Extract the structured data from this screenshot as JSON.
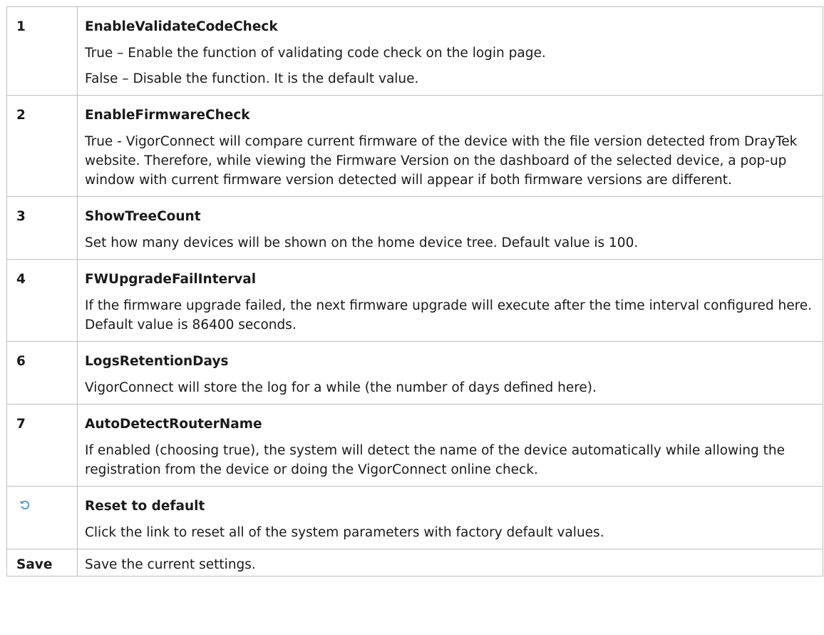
{
  "rows": [
    {
      "key": "1",
      "name": "EnableValidateCodeCheck",
      "lines": [
        "True – Enable the function of validating code check on the login page.",
        "False – Disable the function. It is the default value."
      ]
    },
    {
      "key": "2",
      "name": "EnableFirmwareCheck",
      "lines": [
        "True - VigorConnect will compare current firmware of the device with the file version detected from DrayTek website. Therefore, while viewing the Firmware Version on the dashboard of the selected device, a pop-up window with current firmware version detected will appear if both firmware versions are different."
      ]
    },
    {
      "key": "3",
      "name": "ShowTreeCount",
      "lines": [
        "Set how many devices will be shown on the home device tree. Default value is 100."
      ]
    },
    {
      "key": "4",
      "name": "FWUpgradeFailInterval",
      "lines": [
        "If the firmware upgrade failed, the next firmware upgrade will execute after the time interval configured here. Default value is 86400 seconds."
      ]
    },
    {
      "key": "6",
      "name": "LogsRetentionDays",
      "lines": [
        "VigorConnect will store the log for a while (the number of days defined here)."
      ]
    },
    {
      "key": "7",
      "name": "AutoDetectRouterName",
      "lines": [
        "If enabled (choosing true), the system will detect the name of the device automatically while allowing the registration from the device or doing the VigorConnect online check."
      ]
    },
    {
      "key": "",
      "icon": "reset-icon",
      "name": "Reset to default",
      "lines": [
        "Click the link to reset all of the system parameters with factory default values."
      ]
    },
    {
      "key": "Save",
      "name": "",
      "lines": [
        "Save the current settings."
      ]
    }
  ],
  "colors": {
    "border": "#bfbfbf",
    "icon": "#4a90c8"
  }
}
